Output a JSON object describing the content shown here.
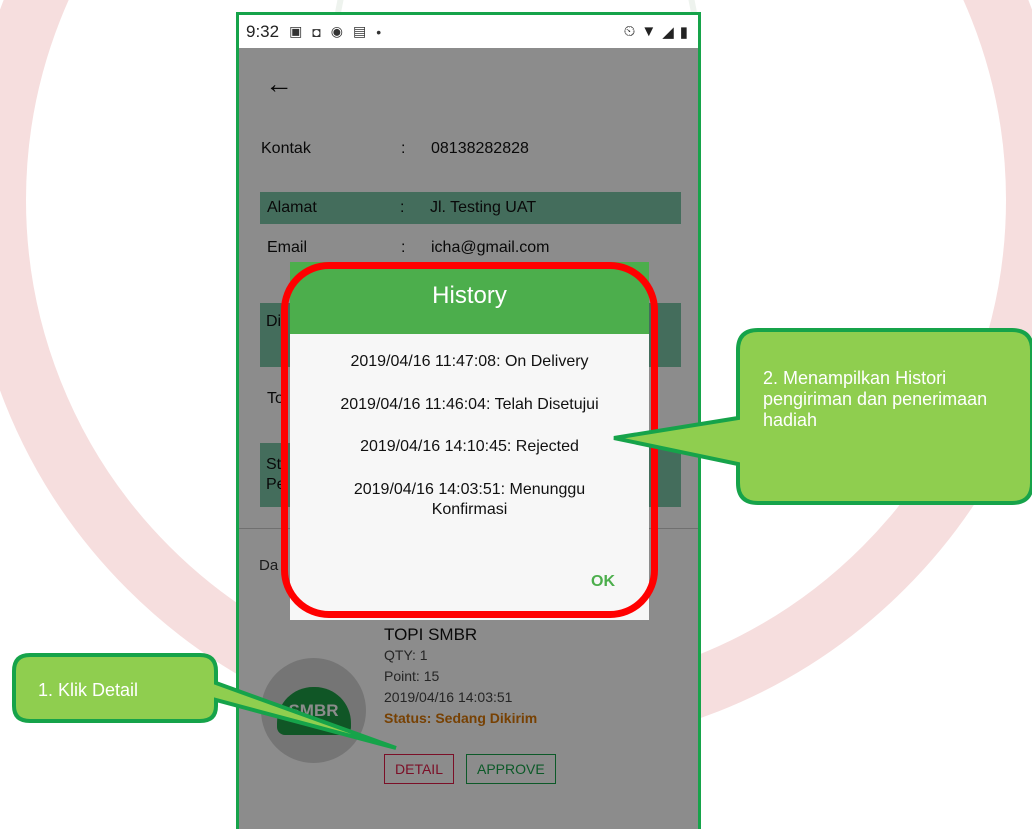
{
  "status_bar": {
    "time": "9:32"
  },
  "profile": {
    "rows": [
      {
        "label": "Kontak",
        "sep": ":",
        "value": "08138282828"
      },
      {
        "label": "Alamat",
        "sep": ":",
        "value": "Jl. Testing UAT"
      },
      {
        "label": "Email",
        "sep": ":",
        "value": "icha@gmail.com"
      }
    ],
    "peek": [
      "Di",
      "To",
      "St",
      "Pe"
    ]
  },
  "list_label": "Da",
  "product": {
    "name": "TOPI SMBR",
    "qty": "QTY: 1",
    "point": "Point: 15",
    "date": "2019/04/16 14:03:51",
    "status": "Status: Sedang Dikirim",
    "cap_text": "SMBR"
  },
  "buttons": {
    "detail": "DETAIL",
    "approve": "APPROVE"
  },
  "dialog": {
    "title": "History",
    "entries": [
      "2019/04/16 11:47:08: On Delivery",
      "2019/04/16 11:46:04: Telah Disetujui",
      "2019/04/16 14:10:45: Rejected",
      "2019/04/16 14:03:51: Menunggu Konfirmasi"
    ],
    "ok": "OK"
  },
  "callouts": {
    "step1": "1. Klik Detail",
    "step2": "2. Menampilkan Histori pengiriman dan penerimaan hadiah"
  },
  "colors": {
    "green_border": "#16a34a",
    "dialog_header": "#4cae4c",
    "highlight": "#ff0000",
    "callout_fill": "#8fce4f"
  }
}
